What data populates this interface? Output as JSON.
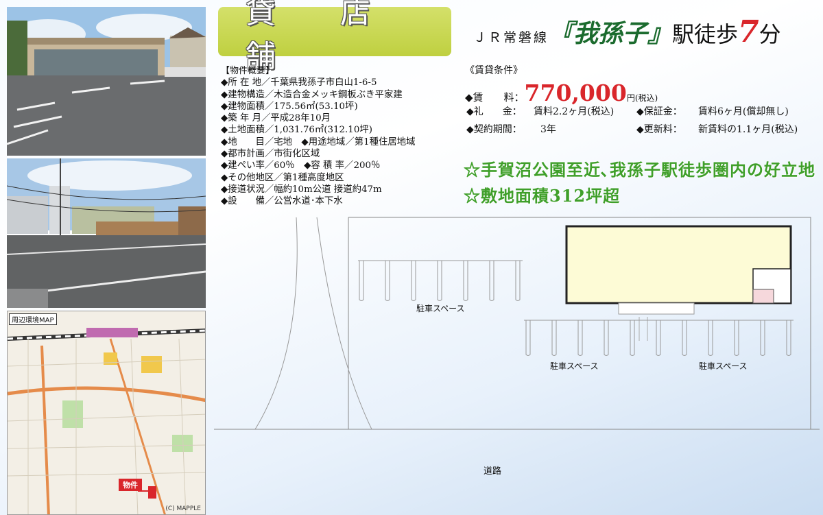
{
  "header": {
    "title": "貸 店 舗",
    "station_line": "ＪＲ常磐線",
    "station_name": "『我孫子』",
    "station_walk": "駅徒歩",
    "walk_minutes": "7",
    "minutes_unit": "分"
  },
  "overview": {
    "heading": "【物件概要】",
    "rows": [
      "◆所 在 地／千葉県我孫子市白山1-6-5",
      "◆建物構造／木造合金メッキ鋼板ぶき平家建",
      "◆建物面積／175.56㎡(53.10坪)",
      "◆築 年 月／平成28年10月",
      "◆土地面積／1,031.76㎡(312.10坪)",
      "◆地　　目／宅地　◆用途地域／第1種住居地域",
      "◆都市計画／市街化区域",
      "◆建ぺい率／60％　◆容 積 率／200％",
      "◆その他地区／第1種高度地区",
      "◆接道状況／幅約10m公道 接道約47m",
      "◆設　　備／公営水道･本下水"
    ]
  },
  "rent": {
    "heading": "《賃貸条件》",
    "rent_label": "◆賃　　料：",
    "rent_value": "770,000",
    "rent_unit": "円(税込)",
    "key_money_label": "◆礼　　金：",
    "key_money_value": "賃料2.2ヶ月(税込)",
    "deposit_label": "◆保証金：",
    "deposit_value": "賃料6ヶ月(償却無し)",
    "term_label": "◆契約期間：",
    "term_value": "3年",
    "renewal_label": "◆更新料：",
    "renewal_value": "新賃料の1.1ヶ月(税込)"
  },
  "highlights": {
    "line1": "☆手賀沼公園至近､我孫子駅徒歩圏内の好立地",
    "line2": "☆敷地面積312坪超"
  },
  "plan": {
    "parking_label_1": "駐車スペース",
    "parking_label_2": "駐車スペース",
    "parking_label_3": "駐車スペース",
    "road_label": "道路"
  },
  "map": {
    "title": "周辺環境MAP",
    "marker_label": "物件",
    "credit": "(C) MAPPLE"
  },
  "colors": {
    "title_bg": "#c6d64e",
    "accent_red": "#d9262b",
    "station_green": "#1b6b2e",
    "highlight_green": "#3f9f2a",
    "building_fill": "#fdfbd6"
  }
}
